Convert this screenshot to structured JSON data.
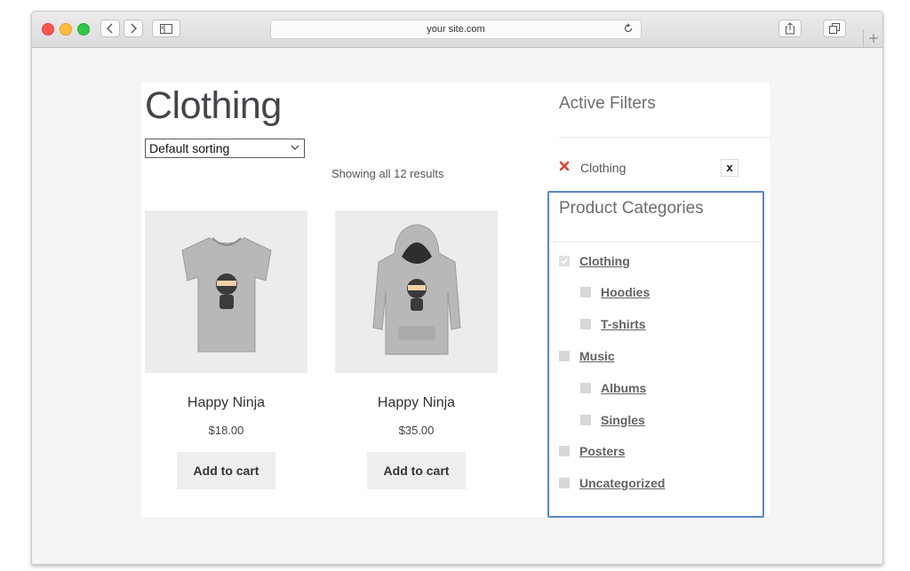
{
  "browser": {
    "url": "your site.com"
  },
  "page": {
    "title": "Clothing",
    "sorting": "Default sorting",
    "results_text": "Showing all 12 results"
  },
  "products": [
    {
      "name": "Happy Ninja",
      "price": "$18.00",
      "button": "Add to cart",
      "image_icon": "tshirt-image"
    },
    {
      "name": "Happy Ninja",
      "price": "$35.00",
      "button": "Add to cart",
      "image_icon": "hoodie-image"
    }
  ],
  "active_filters": {
    "title": "Active Filters",
    "items": [
      {
        "label": "Clothing",
        "remove": "x"
      }
    ]
  },
  "categories": {
    "title": "Product Categories",
    "items": [
      {
        "label": "Clothing",
        "checked": true
      },
      {
        "label": "Hoodies",
        "checked": false
      },
      {
        "label": "T-shirts",
        "checked": false
      },
      {
        "label": "Music",
        "checked": false
      },
      {
        "label": "Albums",
        "checked": false
      },
      {
        "label": "Singles",
        "checked": false
      },
      {
        "label": "Posters",
        "checked": false
      },
      {
        "label": "Uncategorized",
        "checked": false
      }
    ]
  },
  "colors": {
    "highlight_border": "#5b85c7",
    "remove_filter_icon": "#e0453a"
  }
}
